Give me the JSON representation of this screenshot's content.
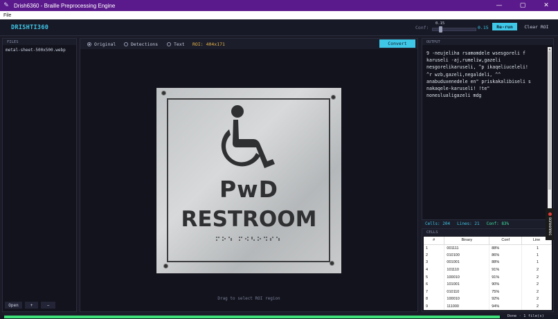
{
  "window": {
    "title": "Drish6360 - Braille Preprocessing Engine",
    "minimize": "—",
    "maximize": "▢",
    "close": "✕",
    "icon": "pencil-icon"
  },
  "menu": {
    "file": "File"
  },
  "header": {
    "brand": "DRISHTI360",
    "conf_label": "Conf:",
    "slider_top_value": "0.15",
    "conf_value": "0.15",
    "slider_level": 0.15,
    "rerun": "Re-run",
    "clear_roi": "Clear ROI"
  },
  "files": {
    "heading": "FILES",
    "items": [
      "metal-sheet-500x500.webp"
    ],
    "open": "Open",
    "add": "+",
    "remove": "−"
  },
  "viewer": {
    "modes": [
      "Original",
      "Detections",
      "Text"
    ],
    "selected_mode": "Original",
    "roi": "ROI: 404x171",
    "convert": "Convert",
    "hint": "Drag to select ROI region",
    "sign_line1": "PwD",
    "sign_line2": "RESTROOM"
  },
  "output": {
    "heading": "OUTPUT",
    "text": "9 -neujeliha rsamomdele wsesgoreli f\nkaruseli -aj,rumeliw,gazeli\nnesgorelikaruseli, ^p ikaqeliuceleli!\n^r wzb,gazeli,negaldeli, ^^\nanabuduxenedele en\" priskakalibiseli s\nnakaqele-karuseli! !te\"\nnoneslualigazeli mdg"
  },
  "stats": {
    "cells": "Cells: 204",
    "lines": "Lines: 21",
    "conf": "Conf: 83%"
  },
  "cells": {
    "heading": "CELLS",
    "columns": [
      "#",
      "Binary",
      "Conf",
      "Line"
    ],
    "rows": [
      [
        "1",
        "001111",
        "88%",
        "1"
      ],
      [
        "2",
        "010100",
        "86%",
        "1"
      ],
      [
        "3",
        "001001",
        "88%",
        "1"
      ],
      [
        "4",
        "101110",
        "91%",
        "2"
      ],
      [
        "5",
        "100010",
        "91%",
        "2"
      ],
      [
        "6",
        "101001",
        "90%",
        "2"
      ],
      [
        "7",
        "010110",
        "75%",
        "2"
      ],
      [
        "8",
        "100010",
        "92%",
        "2"
      ],
      [
        "9",
        "111000",
        "94%",
        "2"
      ]
    ]
  },
  "badge": {
    "label": "screenrec"
  },
  "status": {
    "text": "Done · 1 file(s)",
    "progress": 1.0
  },
  "colors": {
    "accent": "#3fc7e8",
    "titlebar": "#5b1a8c",
    "roi": "#e8b64a",
    "ok": "#3fe07a"
  }
}
